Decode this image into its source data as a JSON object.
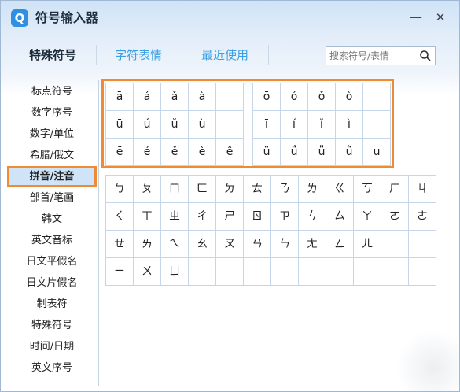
{
  "window": {
    "title": "符号输入器",
    "icon_glyph": "Q",
    "minimize_glyph": "—",
    "close_glyph": "✕"
  },
  "tabs": [
    {
      "label": "特殊符号",
      "active": true
    },
    {
      "label": "字符表情",
      "active": false
    },
    {
      "label": "最近使用",
      "active": false
    }
  ],
  "search": {
    "placeholder": "搜索符号/表情",
    "value": ""
  },
  "sidebar": {
    "items": [
      {
        "label": "标点符号",
        "active": false
      },
      {
        "label": "数字序号",
        "active": false
      },
      {
        "label": "数字/单位",
        "active": false
      },
      {
        "label": "希腊/俄文",
        "active": false
      },
      {
        "label": "拼音/注音",
        "active": true
      },
      {
        "label": "部首/笔画",
        "active": false
      },
      {
        "label": "韩文",
        "active": false
      },
      {
        "label": "英文音标",
        "active": false
      },
      {
        "label": "日文平假名",
        "active": false
      },
      {
        "label": "日文片假名",
        "active": false
      },
      {
        "label": "制表符",
        "active": false
      },
      {
        "label": "特殊符号",
        "active": false
      },
      {
        "label": "时间/日期",
        "active": false
      },
      {
        "label": "英文序号",
        "active": false
      }
    ]
  },
  "pinyin_left": [
    [
      "ā",
      "á",
      "ǎ",
      "à",
      ""
    ],
    [
      "ū",
      "ú",
      "ǔ",
      "ù",
      ""
    ],
    [
      "ē",
      "é",
      "ě",
      "è",
      "ê"
    ]
  ],
  "pinyin_right": [
    [
      "ō",
      "ó",
      "ǒ",
      "ò",
      ""
    ],
    [
      "ī",
      "í",
      "ǐ",
      "ì",
      ""
    ],
    [
      "ü",
      "ǘ",
      "ǚ",
      "ǜ",
      "u"
    ]
  ],
  "zhuyin": [
    [
      "ㄅ",
      "ㄆ",
      "ㄇ",
      "ㄈ",
      "ㄉ",
      "ㄊ",
      "ㄋ",
      "ㄌ",
      "ㄍ",
      "ㄎ",
      "ㄏ",
      "ㄐ"
    ],
    [
      "ㄑ",
      "ㄒ",
      "ㄓ",
      "ㄔ",
      "ㄕ",
      "ㄖ",
      "ㄗ",
      "ㄘ",
      "ㄙ",
      "ㄚ",
      "ㄛ",
      "ㄜ"
    ],
    [
      "ㄝ",
      "ㄞ",
      "ㄟ",
      "ㄠ",
      "ㄡ",
      "ㄢ",
      "ㄣ",
      "ㄤ",
      "ㄥ",
      "ㄦ",
      "",
      ""
    ],
    [
      "ㄧ",
      "ㄨ",
      "ㄩ",
      "",
      "",
      "",
      "",
      "",
      "",
      "",
      "",
      ""
    ]
  ],
  "colors": {
    "accent": "#3aa0e6",
    "highlight": "#ef8a35",
    "grid_line": "#c5d6e8",
    "active_bg": "#cfe4f8"
  }
}
